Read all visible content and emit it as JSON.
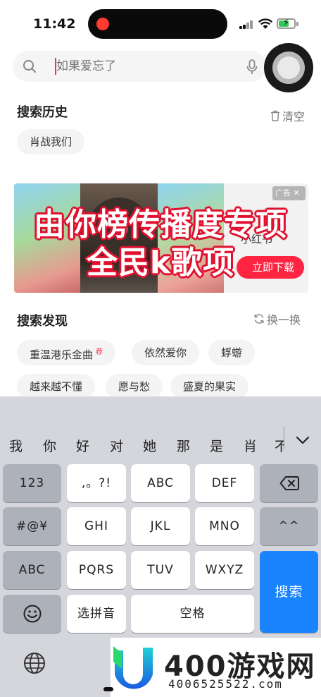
{
  "status_bar": {
    "time": "11:42"
  },
  "search": {
    "placeholder": "如果爱忘了"
  },
  "history": {
    "title": "搜索历史",
    "clear_label": "清空",
    "items": [
      "肖战我们"
    ]
  },
  "banner": {
    "ad_label": "广告",
    "app_label": "小红书",
    "download_label": "立即下载",
    "overlay_line1": "由你榜传播度专项",
    "overlay_line2": "全民k歌项"
  },
  "discover": {
    "title": "搜索发现",
    "refresh_label": "换一换",
    "hot_badge": "荐",
    "items": [
      "重温港乐金曲",
      "依然爱你",
      "蜉蝣",
      "越来越不懂",
      "愿与愁",
      "盛夏的果实"
    ]
  },
  "keyboard": {
    "candidates": [
      "我",
      "你",
      "好",
      "对",
      "她",
      "那",
      "是",
      "肖",
      "不"
    ],
    "rows": [
      [
        "123",
        ",。?!",
        "ABC",
        "DEF"
      ],
      [
        "#@¥",
        "GHI",
        "JKL",
        "MNO",
        "^^"
      ],
      [
        "ABC",
        "PQRS",
        "TUV",
        "WXYZ"
      ],
      [
        "选拼音",
        "空格"
      ]
    ],
    "search_key": "搜索",
    "icons": [
      "backspace-icon",
      "emoji-icon",
      "globe-icon",
      "chevron-down-icon"
    ]
  },
  "watermark": {
    "name": "400游戏网",
    "url": "4006525522.com"
  },
  "colors": {
    "accent": "#ff2442",
    "go_key": "#1a84ff",
    "keyboard_bg": "#d4d6dc"
  }
}
